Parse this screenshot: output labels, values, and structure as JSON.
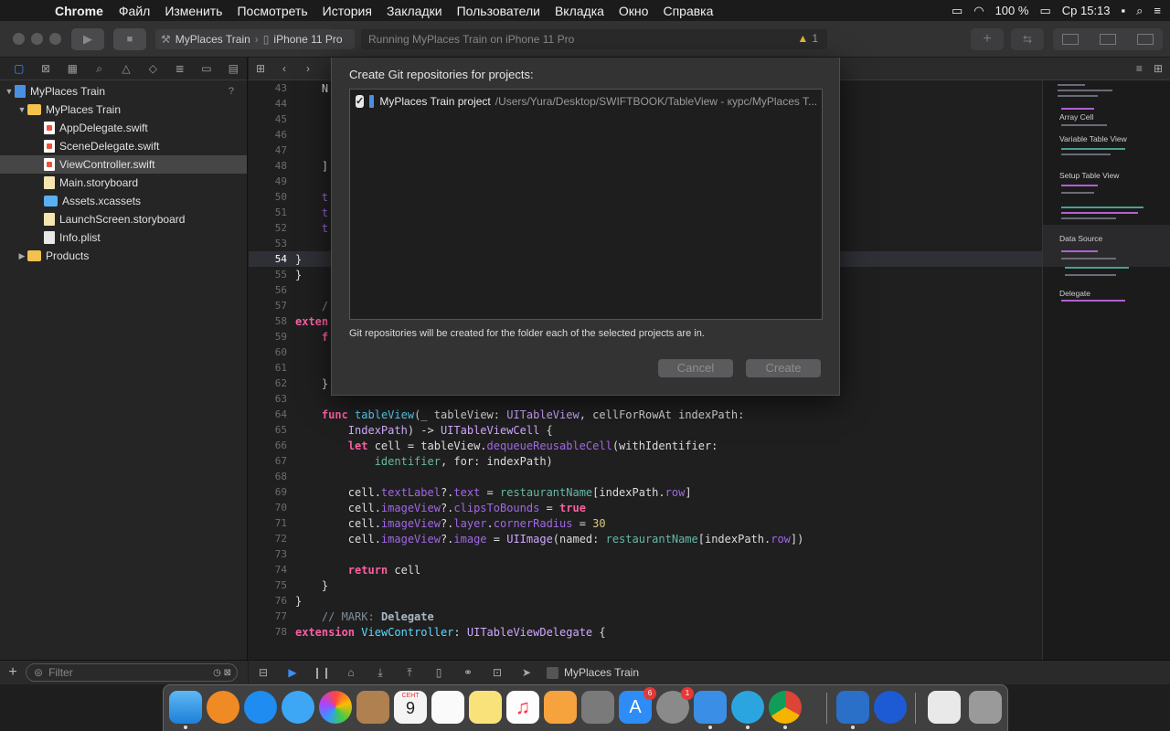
{
  "menubar": {
    "apple_icon": "apple-icon",
    "app": "Chrome",
    "items": [
      "Файл",
      "Изменить",
      "Посмотреть",
      "История",
      "Закладки",
      "Пользователи",
      "Вкладка",
      "Окно",
      "Справка"
    ],
    "battery": "100 %",
    "clock": "Ср 15:13"
  },
  "toolbar": {
    "scheme": "MyPlaces Train",
    "device": "iPhone 11 Pro",
    "status": "Running MyPlaces Train on iPhone 11 Pro",
    "warnings": "1"
  },
  "navigator": {
    "project": "MyPlaces Train",
    "project_mark": "?",
    "group": "MyPlaces Train",
    "files": [
      "AppDelegate.swift",
      "SceneDelegate.swift",
      "ViewController.swift",
      "Main.storyboard",
      "Assets.xcassets",
      "LaunchScreen.storyboard",
      "Info.plist"
    ],
    "products": "Products",
    "filter_placeholder": "Filter"
  },
  "editor": {
    "line_numbers": [
      "43",
      "44",
      "45",
      "46",
      "47",
      "48",
      "49",
      "50",
      "51",
      "52",
      "53",
      "54",
      "55",
      "56",
      "57",
      "58",
      "59",
      "60",
      "61",
      "62",
      "63",
      "64",
      "65",
      "66",
      "67",
      "68",
      "69",
      "70",
      "71",
      "72",
      "73",
      "74",
      "75",
      "76",
      "77",
      "78"
    ],
    "current_line": "54"
  },
  "minimap": {
    "marks": [
      "Array Cell",
      "Variable Table View",
      "Setup Table View",
      "Data Source",
      "Delegate"
    ]
  },
  "debugbar": {
    "target": "MyPlaces Train"
  },
  "dialog": {
    "title": "Create Git repositories for projects:",
    "project_name": "MyPlaces Train project",
    "project_path": "/Users/Yura/Desktop/SWIFTBOOK/TableView - курс/MyPlaces T...",
    "checked": true,
    "note": "Git repositories will be created for the folder each of the selected projects are in.",
    "cancel": "Cancel",
    "create": "Create"
  },
  "dock": {
    "calendar_month": "СЕНТ",
    "calendar_day": "9",
    "appstore_badge": "6",
    "prefs_badge": "1"
  }
}
